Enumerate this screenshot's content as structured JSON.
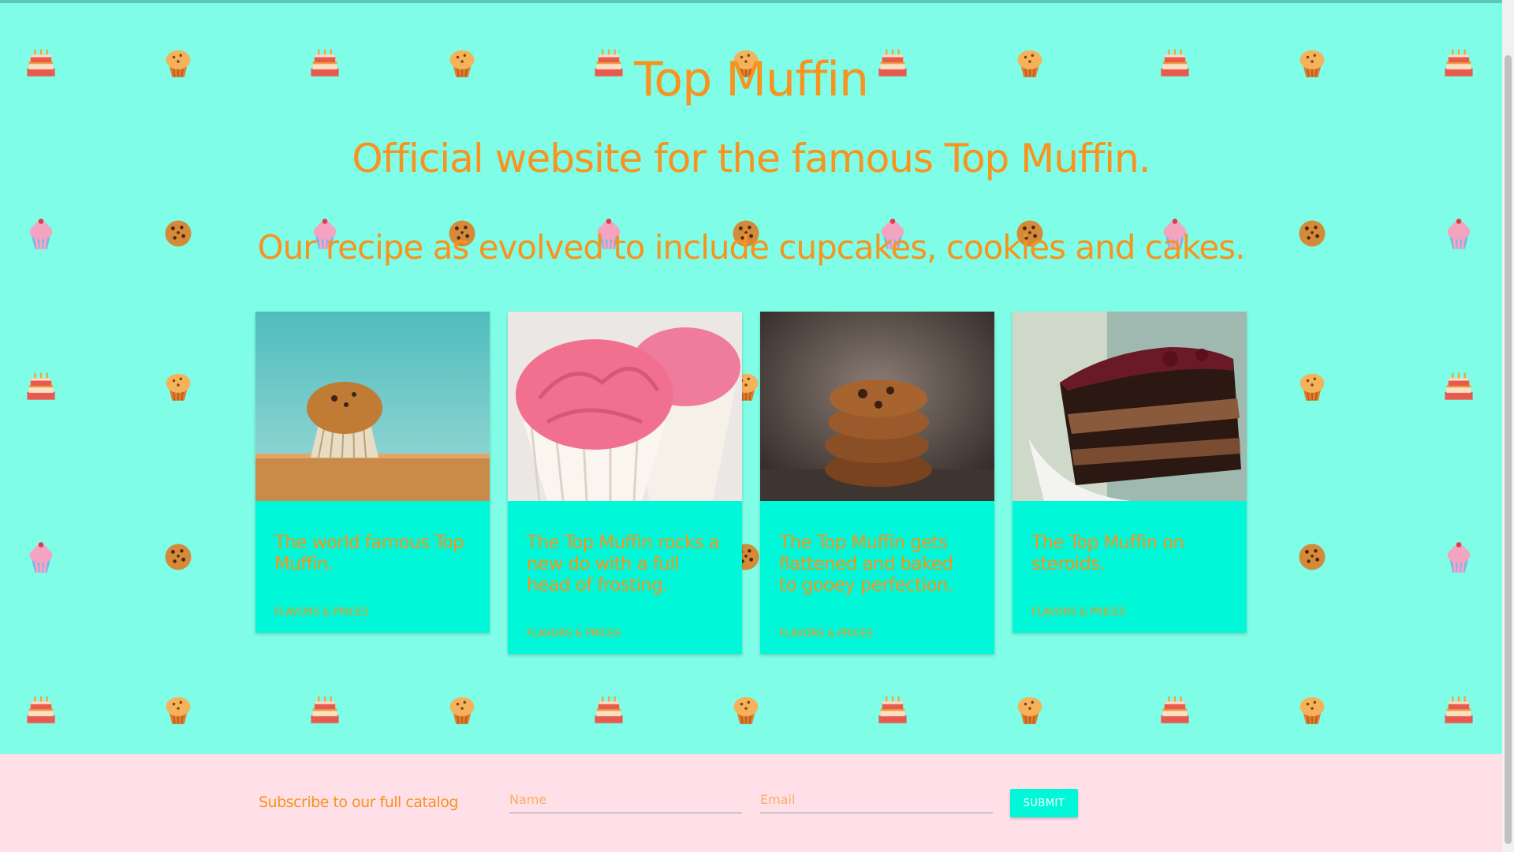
{
  "hero": {
    "title": "Top Muffin",
    "subtitle": "Official website for the famous Top Muffin.",
    "tagline": "Our recipe as evolved to include cupcakes, cookies and cakes."
  },
  "cards": [
    {
      "title": "The world famous Top Muffin.",
      "link": "FLAVORS & PRICES",
      "image_icon": "muffin-photo"
    },
    {
      "title": "The Top Muffin rocks a new do with a full head of frosting.",
      "link": "FLAVORS & PRICES",
      "image_icon": "cupcake-photo"
    },
    {
      "title": "The Top Muffin gets flattened and baked to gooey perfection.",
      "link": "FLAVORS & PRICES",
      "image_icon": "cookies-photo"
    },
    {
      "title": "The Top Muffin on steroids.",
      "link": "FLAVORS & PRICES",
      "image_icon": "cake-photo"
    }
  ],
  "subscribe": {
    "label": "Subscribe to our full catalog",
    "name_placeholder": "Name",
    "email_placeholder": "Email",
    "submit_label": "SUBMIT"
  },
  "colors": {
    "background": "#7ffde6",
    "card": "#00f7d7",
    "accent": "#f7931e",
    "footer": "#ffdfe8"
  }
}
